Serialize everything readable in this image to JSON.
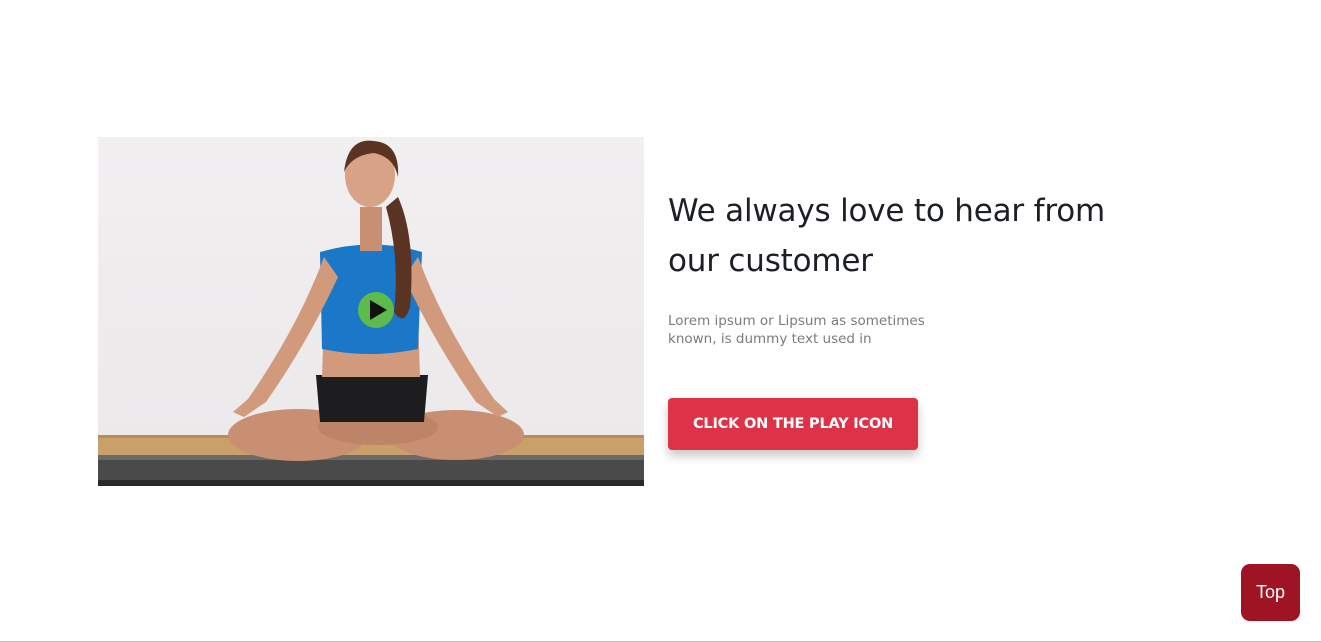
{
  "video_section": {
    "heading": "We always love to hear from our customer",
    "description": "Lorem ipsum or Lipsum as sometimes known, is dummy text used in",
    "cta_label": "CLICK ON THE PLAY ICON",
    "play_icon": "play-icon",
    "image_subject": "woman-meditating-photo"
  },
  "scroll_top": {
    "label": "Top"
  },
  "colors": {
    "cta": "#dd3247",
    "top_button": "#9e1424",
    "play_circle": "#5cbb4c",
    "heading": "#1c1f26",
    "description": "#7b7b7b"
  }
}
